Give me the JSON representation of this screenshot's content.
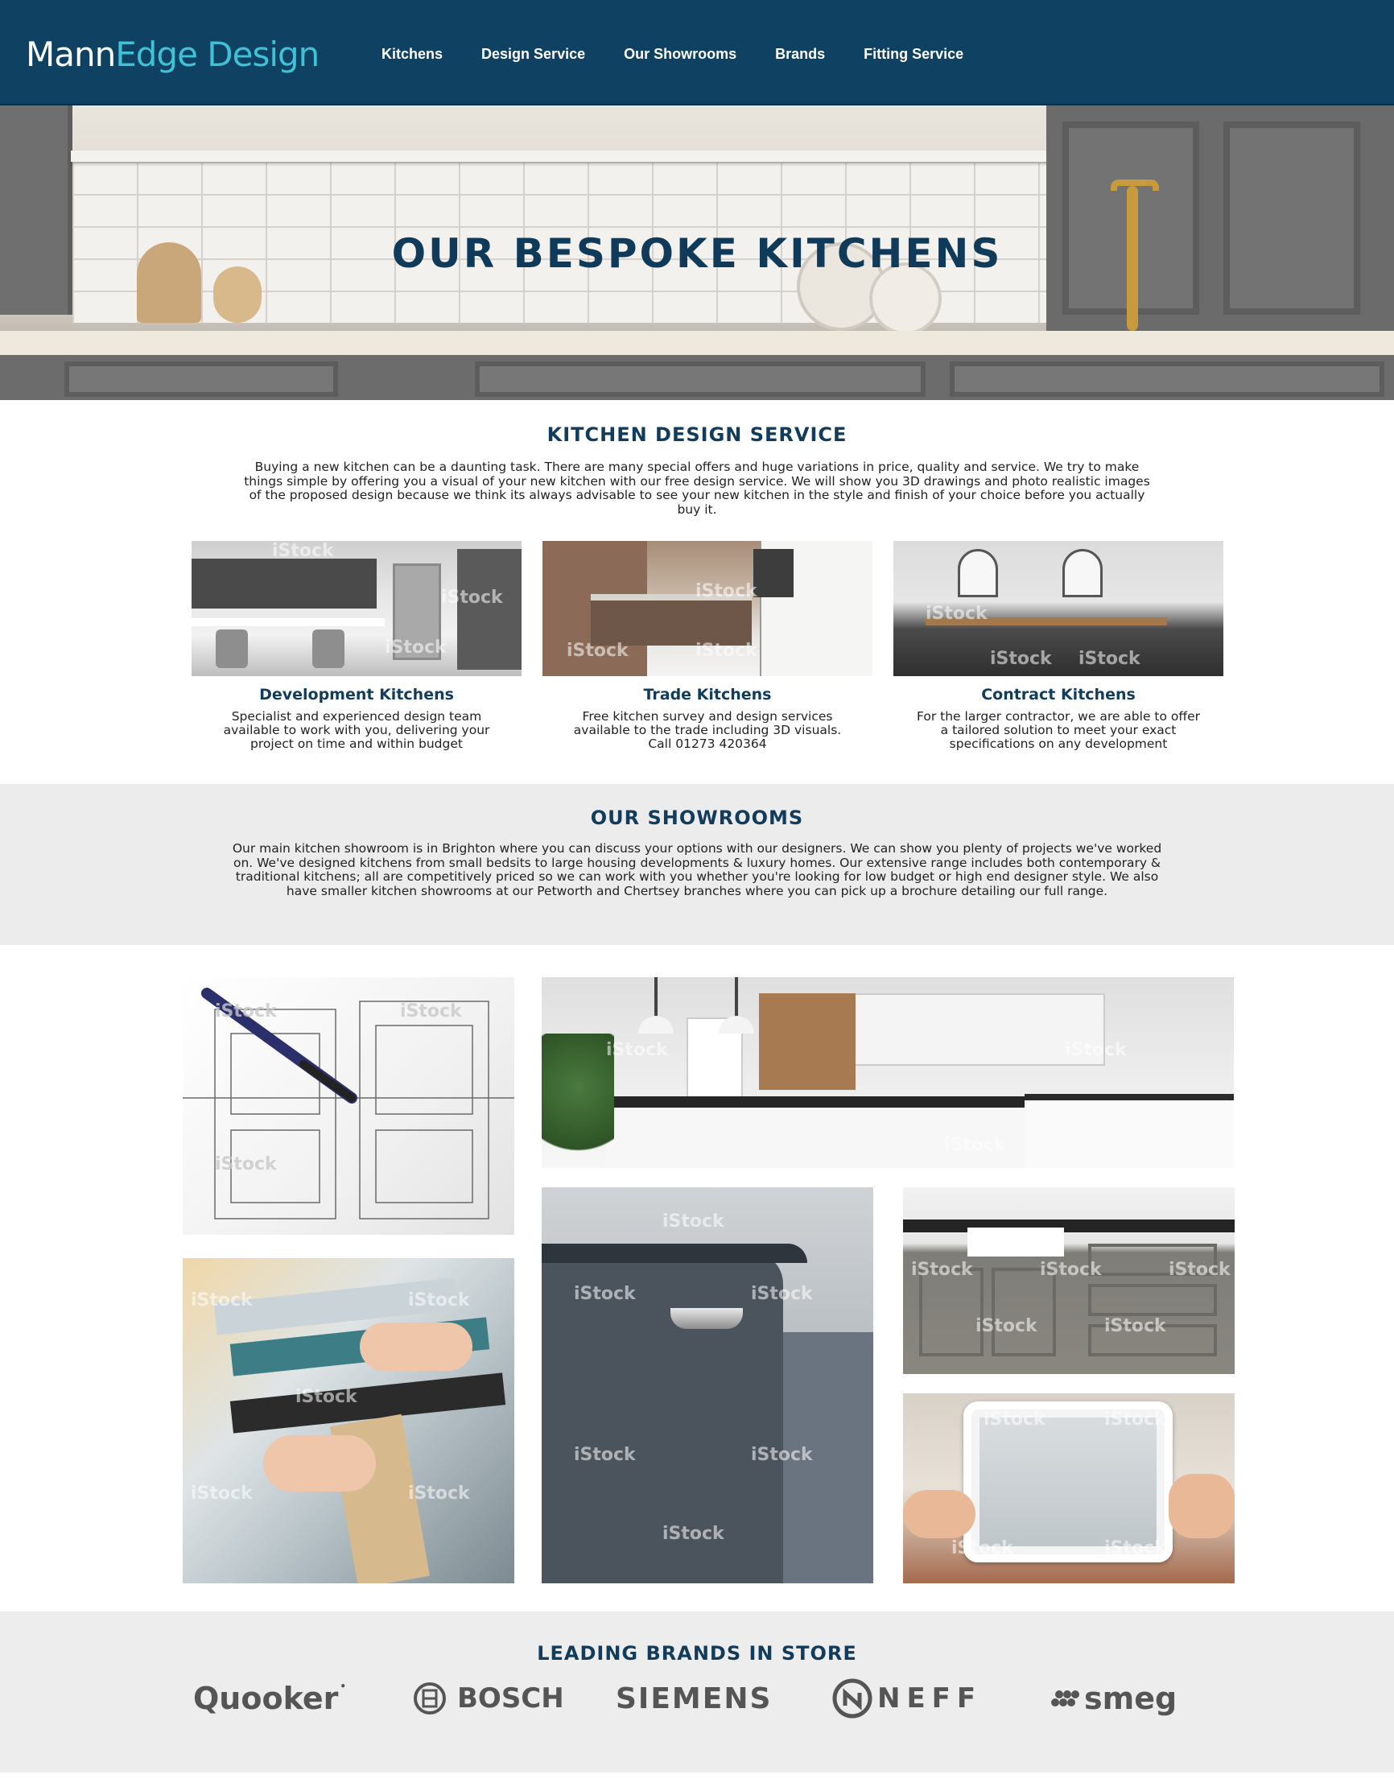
{
  "header": {
    "logo_part1": "Mann",
    "logo_part2": "Edge Design",
    "nav": [
      {
        "label": "Kitchens"
      },
      {
        "label": "Design Service"
      },
      {
        "label": "Our Showrooms"
      },
      {
        "label": "Brands"
      },
      {
        "label": "Fitting Service"
      }
    ]
  },
  "hero": {
    "title": "OUR BESPOKE KITCHENS"
  },
  "design_service": {
    "heading": "KITCHEN DESIGN SERVICE",
    "intro_lines": [
      "Buying a new kitchen can be a daunting task. There are many special offers and huge variations in price, quality and service. We try to make",
      "things simple by offering you a visual of your new kitchen with our free design service. We will show you 3D drawings and photo realistic images",
      "of the proposed design because we think its always advisable to see your new kitchen in the style and finish of your choice before you actually",
      "buy it."
    ],
    "cards": [
      {
        "title": "Development Kitchens",
        "lines": [
          "Specialist and experienced design team",
          "available to work with you, delivering your",
          "project on time and within budget"
        ]
      },
      {
        "title": "Trade Kitchens",
        "lines": [
          "Free kitchen survey and design services",
          "available to the trade including 3D visuals.",
          "Call 01273 420364"
        ]
      },
      {
        "title": "Contract Kitchens",
        "lines": [
          "For the larger contractor, we are able to offer",
          "a tailored solution to meet your exact",
          "specifications on any development"
        ]
      }
    ]
  },
  "showrooms": {
    "heading": "OUR SHOWROOMS",
    "lines": [
      "Our main kitchen showroom is in Brighton where you can discuss your options with our designers. We can show you plenty of projects we've worked",
      "on. We've designed kitchens from small bedsits to large housing developments & luxury homes. Our extensive range includes both contemporary &",
      "traditional kitchens; all are competitively priced so we can work with you whether you're looking for low budget or high end designer style. We also",
      "have smaller kitchen showrooms at our Petworth and Chertsey branches where you can pick up a brochure detailing our full range."
    ]
  },
  "watermark": "iStock",
  "brands": {
    "heading": "LEADING BRANDS IN STORE",
    "items": [
      {
        "name": "Quooker"
      },
      {
        "name": "BOSCH"
      },
      {
        "name": "SIEMENS"
      },
      {
        "name": "NEFF"
      },
      {
        "name": "smeg"
      }
    ]
  },
  "colors": {
    "header_bg": "#0f4162",
    "logo_accent": "#3fc1d6",
    "heading_navy": "#123c5c",
    "band_grey": "#ececec"
  }
}
